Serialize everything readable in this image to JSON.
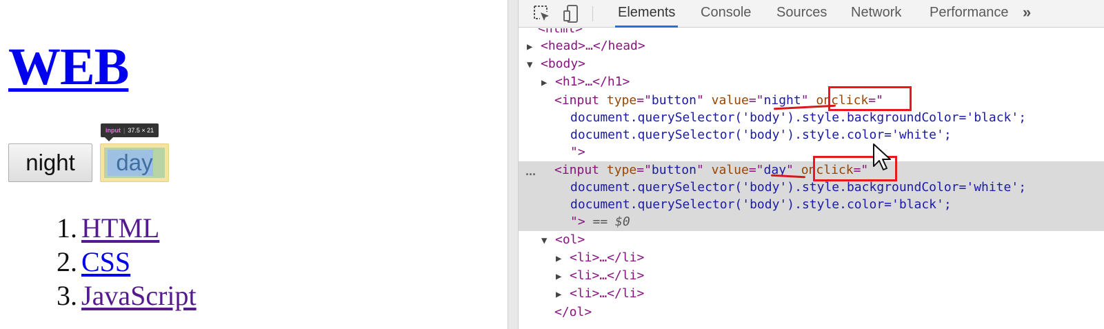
{
  "page": {
    "heading": "WEB",
    "night_button": "night",
    "day_button": "day",
    "tooltip": {
      "tag": "input",
      "size": "37.5 × 21"
    },
    "list": [
      {
        "num": "1.",
        "label": "HTML"
      },
      {
        "num": "2.",
        "label": "CSS"
      },
      {
        "num": "3.",
        "label": "JavaScript"
      }
    ]
  },
  "devtools": {
    "tabs": [
      "Elements",
      "Console",
      "Sources",
      "Network",
      "Performance"
    ],
    "more": "»",
    "dom": {
      "html_open": "<html>",
      "head": "<head>…</head>",
      "body_open": "<body>",
      "h1": "<h1>…</h1>",
      "input1": {
        "tag": "<input",
        "attr_type": "type",
        "val_type": "button",
        "attr_value": "value",
        "val_value": "night",
        "attr_onclick": "onclick"
      },
      "input1_code1": "document.querySelector('body').style.backgroundColor='black';",
      "input1_code2": "document.querySelector('body').style.color='white';",
      "input1_close": "\">",
      "input2": {
        "tag": "<input",
        "attr_type": "type",
        "val_type": "button",
        "attr_value": "value",
        "val_value": "day",
        "attr_onclick": "onclick"
      },
      "input2_code1": "document.querySelector('body').style.backgroundColor='white';",
      "input2_code2": "document.querySelector('body').style.color='black';",
      "input2_close": "\">",
      "selected_marker": "== $0",
      "ol_open": "<ol>",
      "li": "<li>…</li>",
      "ol_close": "</ol>",
      "ellipsis": "..."
    }
  },
  "colors": {
    "link": "#0000ee",
    "visited": "#551a8b",
    "tag": "#881280",
    "attr_name": "#994500",
    "attr_value": "#1a1aa6",
    "annotation": "#e8181d",
    "active_tab": "#1a73e8"
  }
}
